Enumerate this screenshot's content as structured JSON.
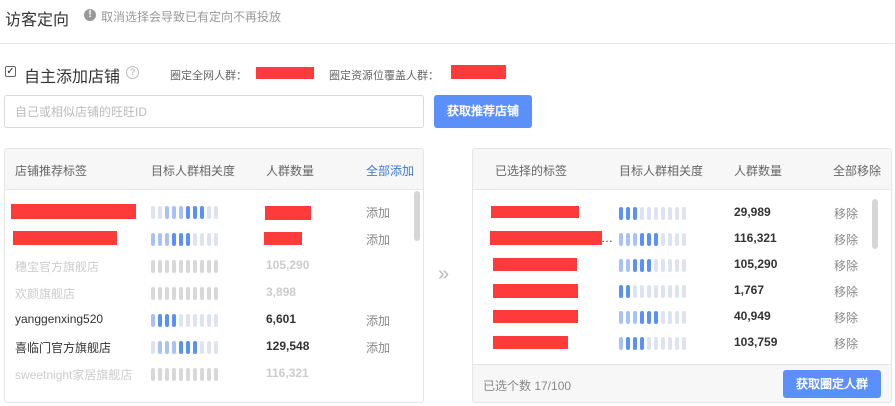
{
  "header": {
    "title": "访客定向",
    "warning": "取消选择会导致已有定向不再投放"
  },
  "self_add": {
    "checked": "✓",
    "label": "自主添加店铺",
    "stat_global_label": "圈定全网人群：",
    "stat_resource_label": "圈定资源位覆盖人群："
  },
  "search": {
    "placeholder": "自己或相似店铺的旺旺ID",
    "button": "获取推荐店铺"
  },
  "left_panel": {
    "col_tag": "店铺推荐标签",
    "col_relevance": "目标人群相关度",
    "col_count": "人群数量",
    "add_all": "全部添加",
    "rows": [
      {
        "name": "",
        "count": "",
        "action": "添加",
        "relevance": 8,
        "disabled": false
      },
      {
        "name": "",
        "count": "",
        "action": "添加",
        "relevance": 6,
        "disabled": false
      },
      {
        "name": "穗宝官方旗舰店",
        "count": "105,290",
        "action": "",
        "relevance": 8,
        "disabled": true
      },
      {
        "name": "欢颜旗舰店",
        "count": "3,898",
        "action": "",
        "relevance": 6,
        "disabled": true
      },
      {
        "name": "yanggenxing520",
        "count": "6,601",
        "action": "添加",
        "relevance": 4,
        "disabled": false
      },
      {
        "name": "喜临门官方旗舰店",
        "count": "129,548",
        "action": "添加",
        "relevance": 7,
        "disabled": false
      },
      {
        "name": "sweetnight家居旗舰店",
        "count": "116,321",
        "action": "",
        "relevance": 6,
        "disabled": true
      }
    ]
  },
  "right_panel": {
    "col_tag": "已选择的标签",
    "col_relevance": "目标人群相关度",
    "col_count": "人群数量",
    "remove_all": "全部移除",
    "rows": [
      {
        "name": "",
        "count": "29,989",
        "action": "移除",
        "relevance": 3
      },
      {
        "name": "…",
        "count": "116,321",
        "action": "移除",
        "relevance": 6
      },
      {
        "name": "",
        "count": "105,290",
        "action": "移除",
        "relevance": 5
      },
      {
        "name": "",
        "count": "1,767",
        "action": "移除",
        "relevance": 2
      },
      {
        "name": "",
        "count": "40,949",
        "action": "移除",
        "relevance": 6
      },
      {
        "name": "",
        "count": "103,759",
        "action": "移除",
        "relevance": 4
      }
    ],
    "selected_count": "已选个数 17/100",
    "lock_button": "获取圈定人群"
  },
  "transfer_icon": "»",
  "colors": {
    "accent": "#5b8ff9",
    "link": "#3a7bd5",
    "redaction": "#ff3a3a"
  }
}
